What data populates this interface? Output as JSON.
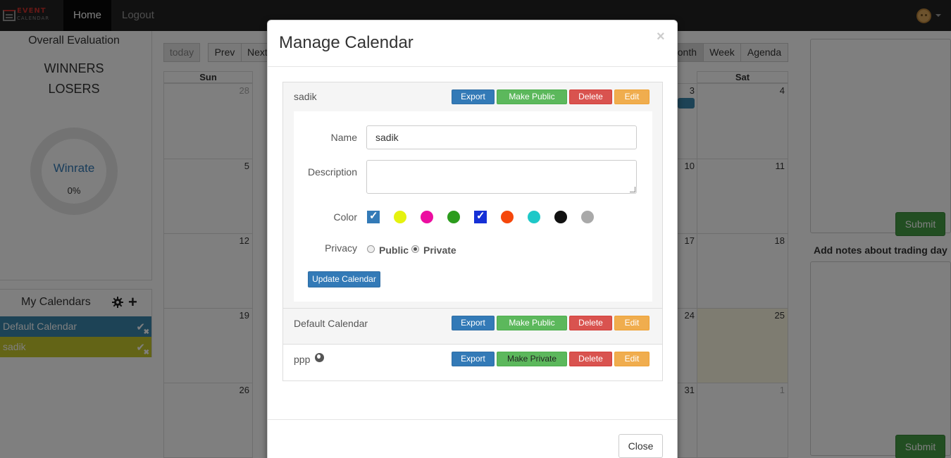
{
  "navbar": {
    "brand_top": "EVENT",
    "brand_bottom": "CALENDAR",
    "home": "Home",
    "logout": "Logout"
  },
  "left_panel": {
    "title": "Overall Evaluation",
    "winners": "WINNERS",
    "losers": "LOSERS",
    "winrate_label": "Winrate",
    "winrate_value": "0%"
  },
  "my_calendars": {
    "title": "My Calendars",
    "items": [
      {
        "label": "Default Calendar",
        "color": "#3a87ad"
      },
      {
        "label": "sadik",
        "color": "#c7c92d"
      }
    ]
  },
  "calendar_toolbar": {
    "today": "today",
    "prev": "Prev",
    "next": "Next",
    "month": "onth",
    "week": "Week",
    "agenda": "Agenda"
  },
  "calendar": {
    "headers": [
      "Sun",
      "Sat"
    ],
    "sun_days": [
      "28",
      "5",
      "12",
      "19",
      "26"
    ],
    "sat_days": [
      "4",
      "11",
      "18",
      "25",
      "1"
    ],
    "fri_days": [
      "3",
      "10",
      "17",
      "24",
      "31"
    ]
  },
  "right_col": {
    "submit": "Submit",
    "notes_label": "Add notes about trading day"
  },
  "modal": {
    "title": "Manage Calendar",
    "close_x": "×",
    "calendars": [
      {
        "name": "sadik",
        "privacy_button": "Make Public",
        "public": false
      },
      {
        "name": "Default Calendar",
        "privacy_button": "Make Public",
        "public": false
      },
      {
        "name": "ppp",
        "privacy_button": "Make Private",
        "public": true
      }
    ],
    "buttons": {
      "export": "Export",
      "delete": "Delete",
      "edit": "Edit"
    },
    "edit_form": {
      "name_label": "Name",
      "name_value": "sadik",
      "description_label": "Description",
      "description_value": "",
      "color_label": "Color",
      "colors": [
        "#337ab7",
        "#e5f20f",
        "#ec0da0",
        "#2c9c1d",
        "#1530d6",
        "#f5470b",
        "#1ec8c8",
        "#111111",
        "#a9a9a9"
      ],
      "selected_colors": [
        0,
        4
      ],
      "privacy_label": "Privacy",
      "public_label": "Public",
      "private_label": "Private",
      "privacy_value": "Private",
      "update_button": "Update Calendar"
    },
    "close_button": "Close"
  }
}
